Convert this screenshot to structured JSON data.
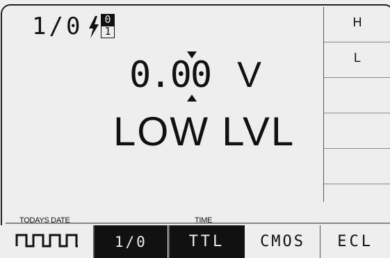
{
  "header": {
    "io_label": "1/0",
    "bit_top": "0",
    "bit_bottom": "1"
  },
  "display": {
    "value": "0.00",
    "unit": "V",
    "status": "LOW LVL"
  },
  "side_menu": {
    "items": [
      {
        "label": "H"
      },
      {
        "label": "L"
      },
      {
        "label": ""
      },
      {
        "label": ""
      },
      {
        "label": ""
      },
      {
        "label": ""
      }
    ]
  },
  "footer": {
    "date_label": "TODAYS DATE",
    "time_label": "TIME"
  },
  "softkeys": {
    "wave_icon": "square-wave-icon",
    "io": "1/0",
    "ttl": "TTL",
    "cmos": "CMOS",
    "ecl": "ECL",
    "active": [
      "1/0",
      "TTL"
    ]
  },
  "colors": {
    "background": "#eeeeee",
    "foreground": "#111111",
    "grid": "#888888"
  }
}
